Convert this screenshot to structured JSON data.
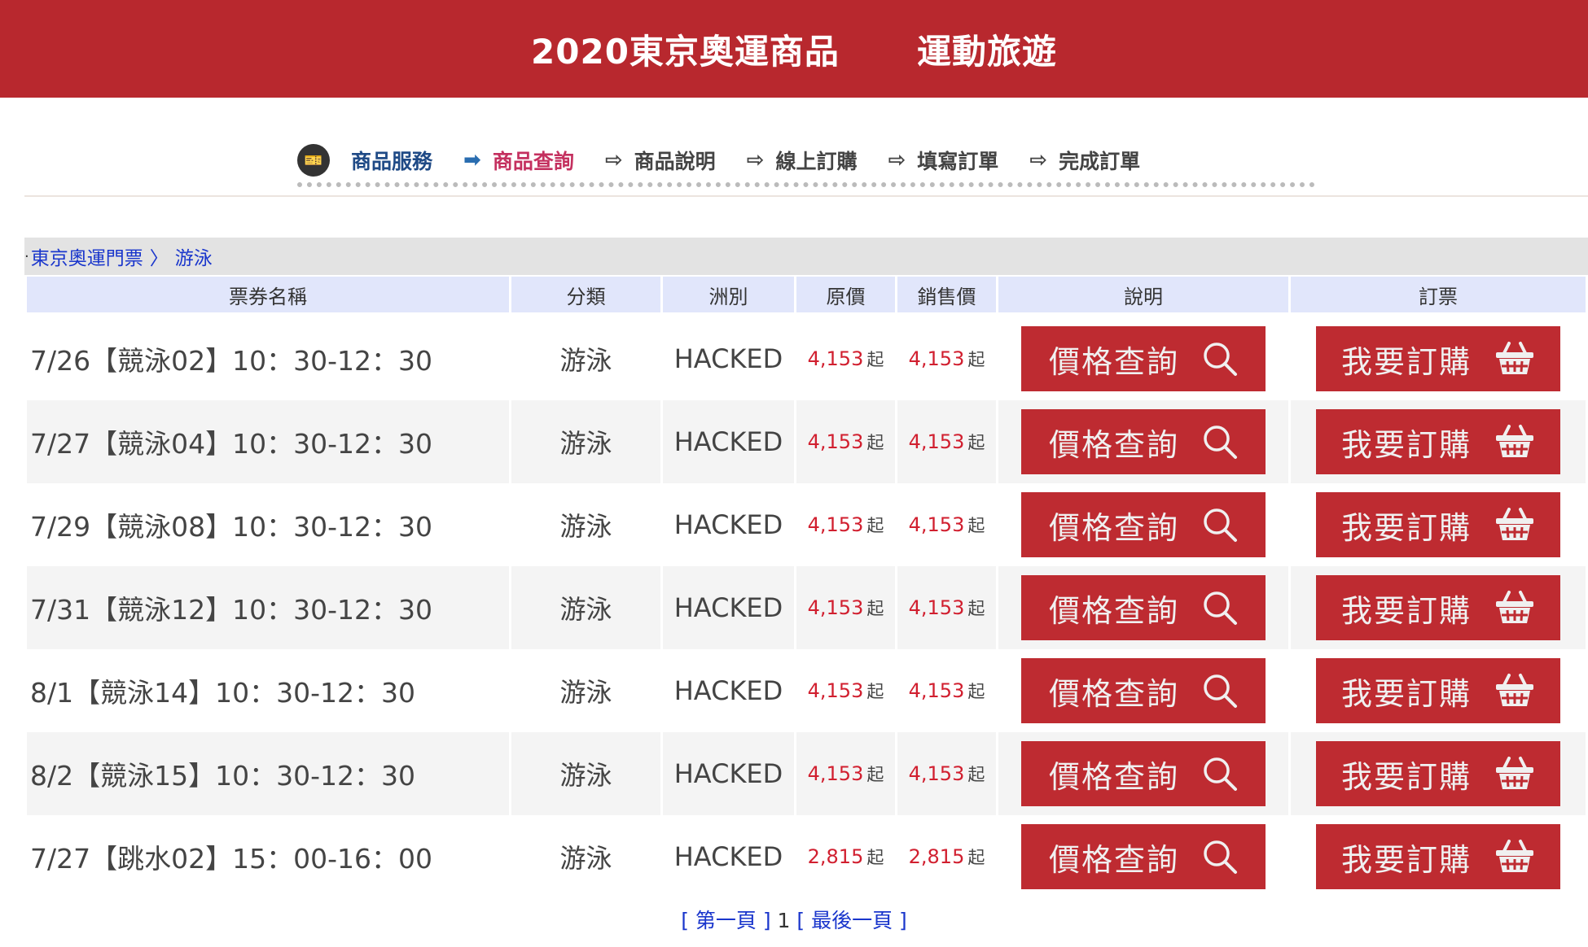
{
  "header": {
    "left": "2020東京奧運商品",
    "right": "運動旅遊"
  },
  "steps": {
    "service": "商品服務",
    "items": [
      "商品查詢",
      "商品說明",
      "線上訂購",
      "填寫訂單",
      "完成訂單"
    ]
  },
  "breadcrumb": {
    "level1": "東京奧運門票",
    "separator": "〉",
    "level2": "游泳"
  },
  "table": {
    "headers": [
      "票券名稱",
      "分類",
      "洲別",
      "原價",
      "銷售價",
      "說明",
      "訂票"
    ],
    "qi_suffix": "起",
    "info_button": "價格查詢",
    "order_button": "我要訂購",
    "rows": [
      {
        "name": "7/26【競泳02】10：30-12：30",
        "category": "游泳",
        "region": "HACKED",
        "orig": "4,153",
        "sale": "4,153"
      },
      {
        "name": "7/27【競泳04】10：30-12：30",
        "category": "游泳",
        "region": "HACKED",
        "orig": "4,153",
        "sale": "4,153"
      },
      {
        "name": "7/29【競泳08】10：30-12：30",
        "category": "游泳",
        "region": "HACKED",
        "orig": "4,153",
        "sale": "4,153"
      },
      {
        "name": "7/31【競泳12】10：30-12：30",
        "category": "游泳",
        "region": "HACKED",
        "orig": "4,153",
        "sale": "4,153"
      },
      {
        "name": "8/1【競泳14】10：30-12：30",
        "category": "游泳",
        "region": "HACKED",
        "orig": "4,153",
        "sale": "4,153"
      },
      {
        "name": "8/2【競泳15】10：30-12：30",
        "category": "游泳",
        "region": "HACKED",
        "orig": "4,153",
        "sale": "4,153"
      },
      {
        "name": "7/27【跳水02】15：00-16：00",
        "category": "游泳",
        "region": "HACKED",
        "orig": "2,815",
        "sale": "2,815"
      }
    ]
  },
  "pager": {
    "first": "[ 第一頁 ]",
    "current": "1",
    "last": "[ 最後一頁 ]"
  },
  "colors": {
    "brand_red": "#b8282e",
    "link_blue": "#1a36cc",
    "price_red": "#d11f2f"
  }
}
